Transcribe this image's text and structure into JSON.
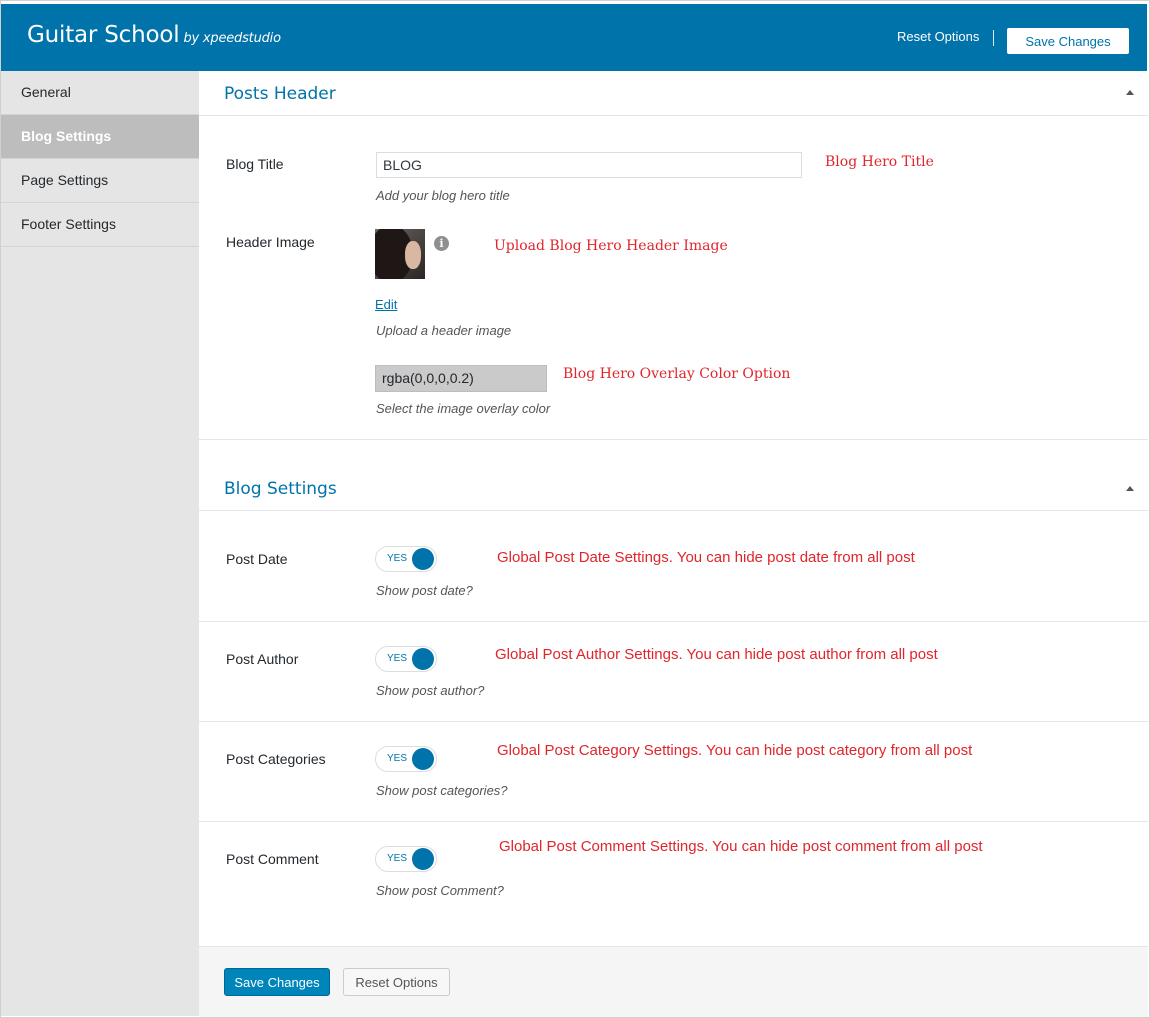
{
  "header": {
    "title": "Guitar School",
    "byline": "by xpeedstudio",
    "reset_label": "Reset Options",
    "save_label": "Save Changes"
  },
  "sidebar": {
    "items": [
      {
        "label": "General",
        "active": false
      },
      {
        "label": "Blog Settings",
        "active": true
      },
      {
        "label": "Page Settings",
        "active": false
      },
      {
        "label": "Footer Settings",
        "active": false
      }
    ]
  },
  "posts_header": {
    "title": "Posts Header",
    "blog_title": {
      "label": "Blog Title",
      "value": "BLOG",
      "description": "Add your blog hero title",
      "note": "Blog Hero Title"
    },
    "header_image": {
      "label": "Header Image",
      "edit_label": "Edit",
      "description": "Upload a header image",
      "note": "Upload Blog Hero Header Image",
      "info_icon": "i"
    },
    "overlay": {
      "value": "rgba(0,0,0,0.2)",
      "description": "Select the image overlay color",
      "note": "Blog Hero Overlay Color Option"
    }
  },
  "blog_settings": {
    "title": "Blog Settings",
    "toggles": [
      {
        "label": "Post Date",
        "state": "YES",
        "description": "Show post date?",
        "note": "Global Post Date Settings. You can hide post date from all post"
      },
      {
        "label": "Post Author",
        "state": "YES",
        "description": "Show post author?",
        "note": "Global Post Author Settings. You can hide post author from all post"
      },
      {
        "label": "Post Categories",
        "state": "YES",
        "description": "Show post categories?",
        "note": "Global Post Category Settings. You can hide post category from all post"
      },
      {
        "label": "Post Comment",
        "state": "YES",
        "description": "Show post Comment?",
        "note": "Global Post Comment Settings. You can hide post comment from all post"
      }
    ]
  },
  "footer": {
    "save_label": "Save Changes",
    "reset_label": "Reset Options"
  },
  "colors": {
    "brand": "#0073aa",
    "primary_button": "#0085ba",
    "annotation": "#e0252b"
  }
}
